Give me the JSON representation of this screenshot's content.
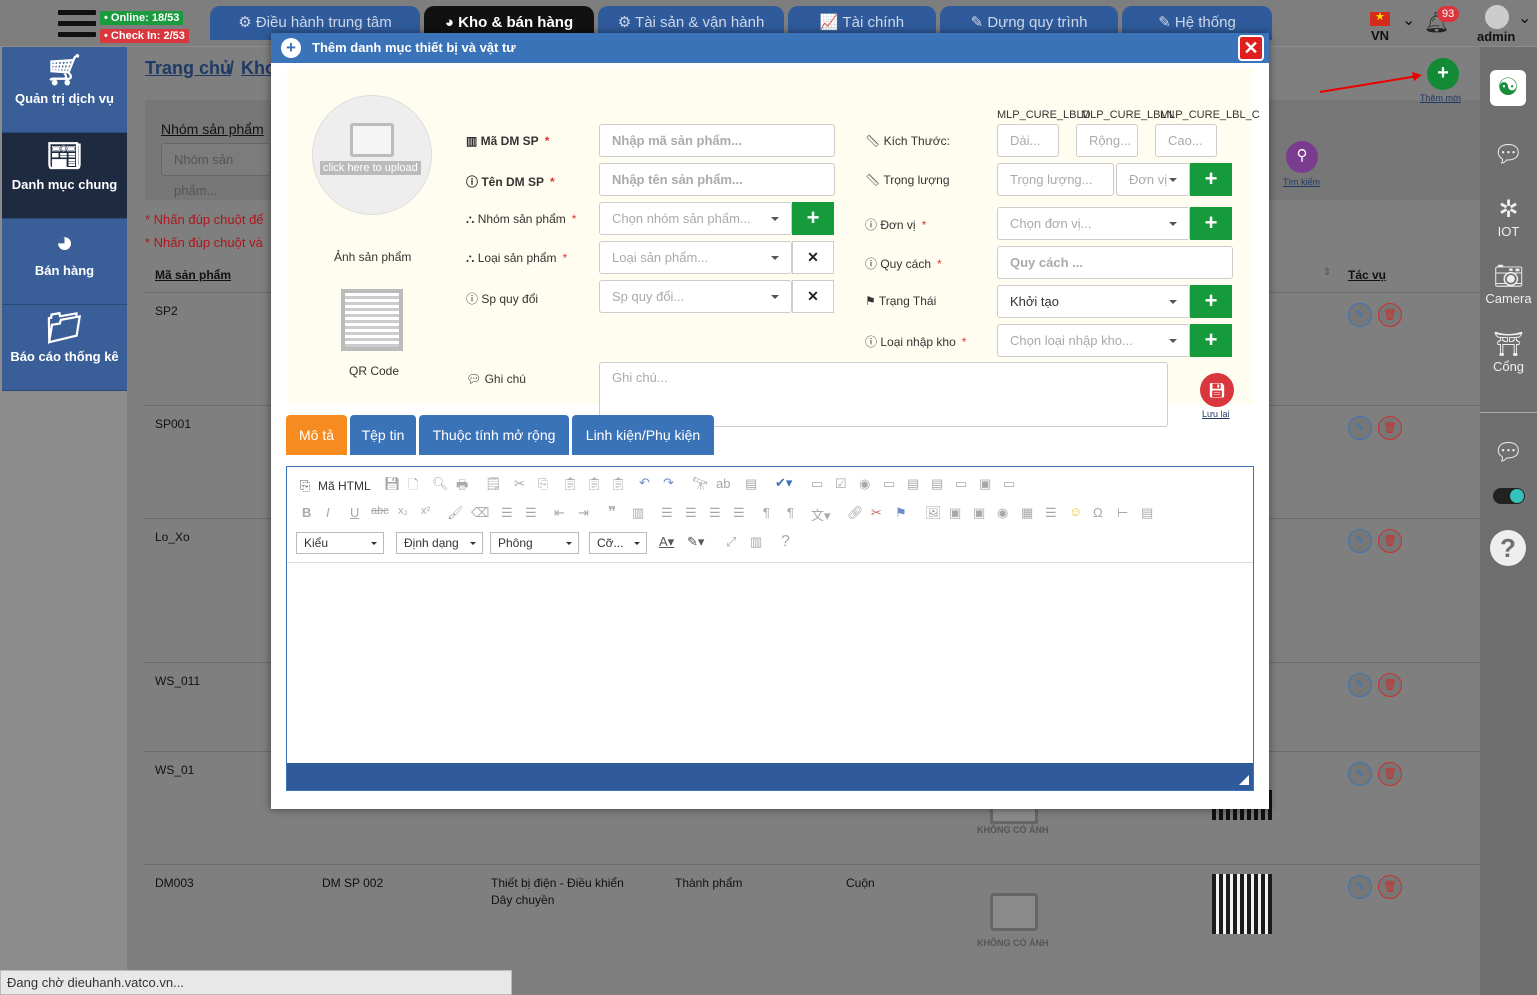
{
  "topbar": {
    "online": "• Online: 18/53",
    "checkin": "• Check In: 2/53",
    "lang": "VN",
    "notif_count": "93",
    "user": "admin",
    "tabs": [
      {
        "label": "⚙ Điều hành trung tâm"
      },
      {
        "label": "◕ Kho & bán hàng"
      },
      {
        "label": "⚙ Tài sản & vận hành"
      },
      {
        "label": "📈 Tài chính"
      },
      {
        "label": "✎ Dựng quy trình"
      },
      {
        "label": "✎ Hệ thống"
      }
    ]
  },
  "sidebar": {
    "items": [
      {
        "label": "Quản trị dịch vụ"
      },
      {
        "label": "Danh mục chung"
      },
      {
        "label": "Bán hàng"
      },
      {
        "label": "Báo cáo thống kê"
      }
    ]
  },
  "page": {
    "breadcrumb_home": "Trang chủ",
    "breadcrumb_sep": "/",
    "breadcrumb_kho": "Kho",
    "group_label": "Nhóm sản phẩm",
    "group_placeholder": "Nhóm sản phẩm...",
    "hint1": "* Nhấn đúp chuột để",
    "hint2": "* Nhấn đúp chuột và",
    "add_new": "Thêm mới",
    "search": "Tìm kiếm",
    "col_code": "Mã sản phẩm",
    "col_action": "Tác vụ",
    "no_image": "KHÔNG CÓ ẢNH",
    "rows": [
      {
        "code": "SP2"
      },
      {
        "code": "SP001"
      },
      {
        "code": "Lo_Xo"
      },
      {
        "code": "WS_011"
      },
      {
        "code": "WS_01"
      },
      {
        "code": "DM003",
        "name": "DM SP 002",
        "group": "Thiết bị điện - Điều khiển",
        "group2": "Dây chuyền",
        "type": "Thành phẩm",
        "unit": "Cuộn"
      }
    ]
  },
  "rightbar": {
    "iot": "IOT",
    "camera": "Camera",
    "gate": "Cổng"
  },
  "modal": {
    "title": "Thêm danh mục thiết bị và vật tư",
    "upload": "click here to upload",
    "image_label": "Ảnh sản phẩm",
    "qr_label": "QR Code",
    "f_code_label": "Mã DM SP",
    "f_code_ph": "Nhập mã sản phẩm...",
    "f_name_label": "Tên DM SP",
    "f_name_ph": "Nhập tên sản phẩm...",
    "f_group_label": "Nhóm sản phẩm",
    "f_group_ph": "Chọn nhóm sản phẩm...",
    "f_type_label": "Loại sản phẩm",
    "f_type_ph": "Loại sản phẩm...",
    "f_conv_label": "Sp quy đổi",
    "f_conv_ph": "Sp quy đổi...",
    "f_note_label": "Ghi chú",
    "f_note_ph": "Ghi chú...",
    "f_size_label": "Kích Thước:",
    "size_hdr1": "MLP_CURE_LBLD",
    "size_hdr2": "MLP_CURE_LBLN",
    "size_hdr3": "MLP_CURE_LBL_C",
    "size_l_ph": "Dài...",
    "size_w_ph": "Rộng...",
    "size_h_ph": "Cao...",
    "f_weight_label": "Trọng lượng",
    "f_weight_ph": "Trọng lượng...",
    "f_weight_unit": "Đơn vị",
    "f_unit_label": "Đơn vị",
    "f_unit_ph": "Chọn đơn vị...",
    "f_spec_label": "Quy cách",
    "f_spec_ph": "Quy cách ...",
    "f_status_label": "Trạng Thái",
    "f_status_val": "Khởi tạo",
    "f_import_label": "Loại nhập kho",
    "f_import_ph": "Chọn loại nhập kho...",
    "save": "Lưu lại",
    "tabs": [
      {
        "label": "Mô tả"
      },
      {
        "label": "Tệp tin"
      },
      {
        "label": "Thuộc tính mở rộng"
      },
      {
        "label": "Linh kiện/Phụ kiện"
      }
    ],
    "editor": {
      "source": "Mã HTML",
      "style": "Kiểu",
      "format": "Định dạng",
      "font": "Phông",
      "size": "Cỡ..."
    }
  },
  "statusbar": "Đang chờ dieuhanh.vatco.vn..."
}
